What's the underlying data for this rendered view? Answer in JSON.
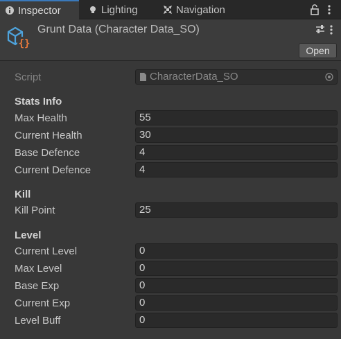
{
  "tabs": [
    {
      "label": "Inspector",
      "icon": "info-icon",
      "active": true
    },
    {
      "label": "Lighting",
      "icon": "lightbulb-icon",
      "active": false
    },
    {
      "label": "Navigation",
      "icon": "navigation-icon",
      "active": false
    }
  ],
  "header": {
    "title": "Grunt Data (Character Data_SO)",
    "open_label": "Open",
    "asset_icon": "scriptable-object-icon"
  },
  "script": {
    "label": "Script",
    "value": "CharacterData_SO"
  },
  "sections": {
    "stats": {
      "title": "Stats Info",
      "fields": [
        {
          "label": "Max Health",
          "value": "55"
        },
        {
          "label": "Current Health",
          "value": "30"
        },
        {
          "label": "Base Defence",
          "value": "4"
        },
        {
          "label": "Current Defence",
          "value": "4"
        }
      ]
    },
    "kill": {
      "title": "Kill",
      "fields": [
        {
          "label": "Kill Point",
          "value": "25"
        }
      ]
    },
    "level": {
      "title": "Level",
      "fields": [
        {
          "label": "Current Level",
          "value": "0"
        },
        {
          "label": "Max Level",
          "value": "0"
        },
        {
          "label": "Base Exp",
          "value": "0"
        },
        {
          "label": "Current Exp",
          "value": "0"
        },
        {
          "label": "Level Buff",
          "value": "0"
        }
      ]
    }
  },
  "colors": {
    "background": "#383838",
    "field": "#2a2a2a",
    "tab_active_accent": "#3a79bb",
    "asset_icon_blue": "#4ea3dc",
    "asset_icon_orange": "#e87a3c"
  }
}
